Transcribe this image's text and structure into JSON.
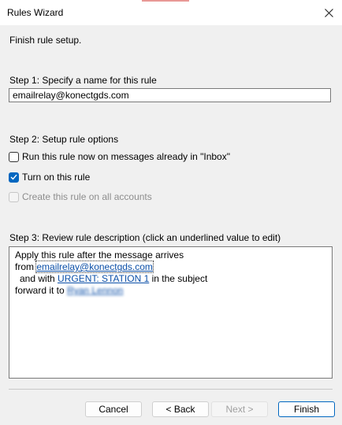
{
  "window": {
    "title": "Rules Wizard"
  },
  "intro": "Finish rule setup.",
  "step1": {
    "label": "Step 1: Specify a name for this rule",
    "name_value": "emailrelay@konectgds.com"
  },
  "step2": {
    "label": "Step 2: Setup rule options",
    "options": [
      {
        "label": "Run this rule now on messages already in \"Inbox\"",
        "checked": false,
        "enabled": true
      },
      {
        "label": "Turn on this rule",
        "checked": true,
        "enabled": true
      },
      {
        "label": "Create this rule on all accounts",
        "checked": false,
        "enabled": false
      }
    ]
  },
  "step3": {
    "label": "Step 3: Review rule description (click an underlined value to edit)",
    "line1": "Apply this rule after the message arrives",
    "line2_prefix": "from ",
    "line2_link": "emailrelay@konectgds.com",
    "line3_prefix": "and with ",
    "line3_link": "URGENT: STATION 1",
    "line3_suffix": " in the subject",
    "line4_prefix": "forward it to ",
    "line4_link": "Ryan Lennon"
  },
  "buttons": {
    "cancel": "Cancel",
    "back": "< Back",
    "next": "Next >",
    "finish": "Finish"
  },
  "colors": {
    "accent": "#0067c0",
    "link": "#0b4fa8"
  }
}
